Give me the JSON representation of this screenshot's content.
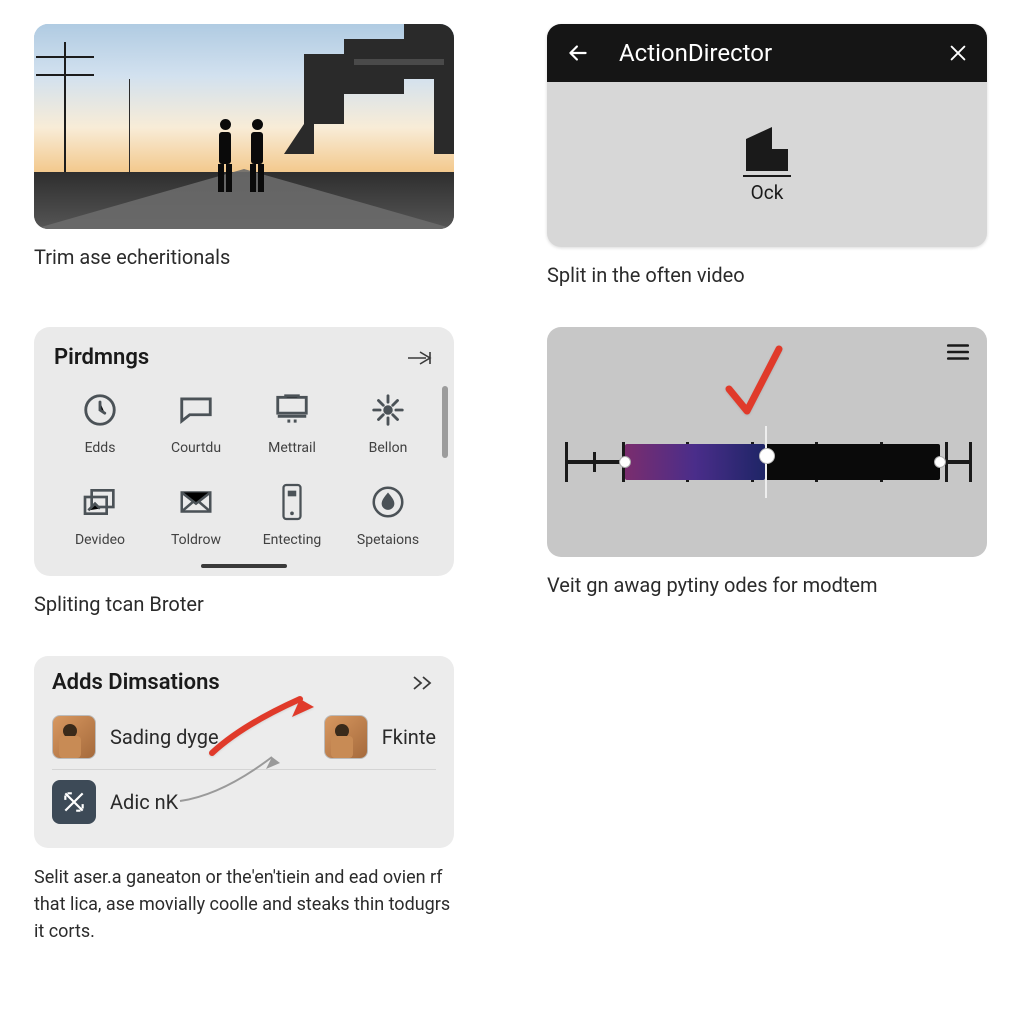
{
  "captions": {
    "trim": "Trim ase echeritionals",
    "split": "Split in the often video",
    "spliting": "Spliting tcan Broter",
    "veit": "Veit gn awag pytiny odes for modtem"
  },
  "ad_panel": {
    "title": "ActionDirector",
    "ock_label": "Ock"
  },
  "palette": {
    "title": "Pirdmngs",
    "tools": [
      {
        "name": "edds",
        "label": "Edds"
      },
      {
        "name": "courtdu",
        "label": "Courtdu"
      },
      {
        "name": "mettrail",
        "label": "Mettrail"
      },
      {
        "name": "bellon",
        "label": "Bellon"
      },
      {
        "name": "devideo",
        "label": "Devideo"
      },
      {
        "name": "toldrow",
        "label": "Toldrow"
      },
      {
        "name": "entecting",
        "label": "Entecting"
      },
      {
        "name": "spetaions",
        "label": "Spetaions"
      }
    ]
  },
  "adds": {
    "title": "Adds Dimsations",
    "row1_a": "Sading dyge",
    "row1_b": "Fkinte",
    "row2": "Adic nK"
  },
  "body_text": "Selit aser.a ganeaton or the'en'tiein and ead ovien rf that lica, ase movially coolle and steaks thin todugrs it corts."
}
